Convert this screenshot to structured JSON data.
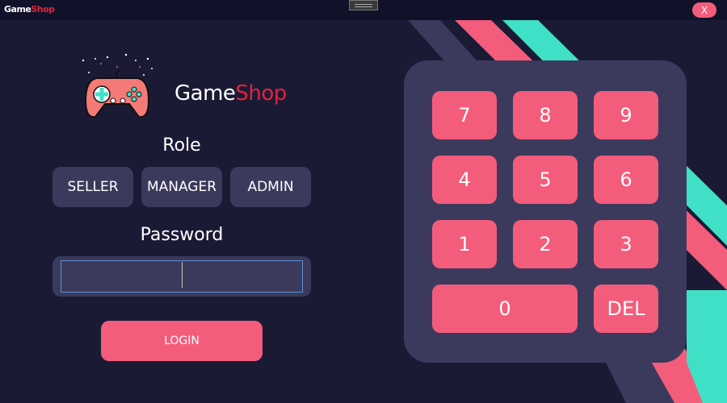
{
  "titlebar": {
    "brand_part1": "Game",
    "brand_part2": "Shop",
    "close_label": "X"
  },
  "logo": {
    "text_part1": "Game",
    "text_part2": "Shop"
  },
  "role": {
    "label": "Role",
    "buttons": [
      "SELLER",
      "MANAGER",
      "ADMIN"
    ]
  },
  "password": {
    "label": "Password",
    "value": ""
  },
  "login": {
    "label": "LOGIN"
  },
  "keypad": {
    "keys": [
      "7",
      "8",
      "9",
      "4",
      "5",
      "6",
      "1",
      "2",
      "3",
      "0",
      "DEL"
    ]
  },
  "colors": {
    "background": "#1b1a35",
    "panel": "#3b3a5c",
    "accent": "#f45c7b",
    "teal": "#3fe0c5",
    "brand_red": "#e0233c"
  }
}
